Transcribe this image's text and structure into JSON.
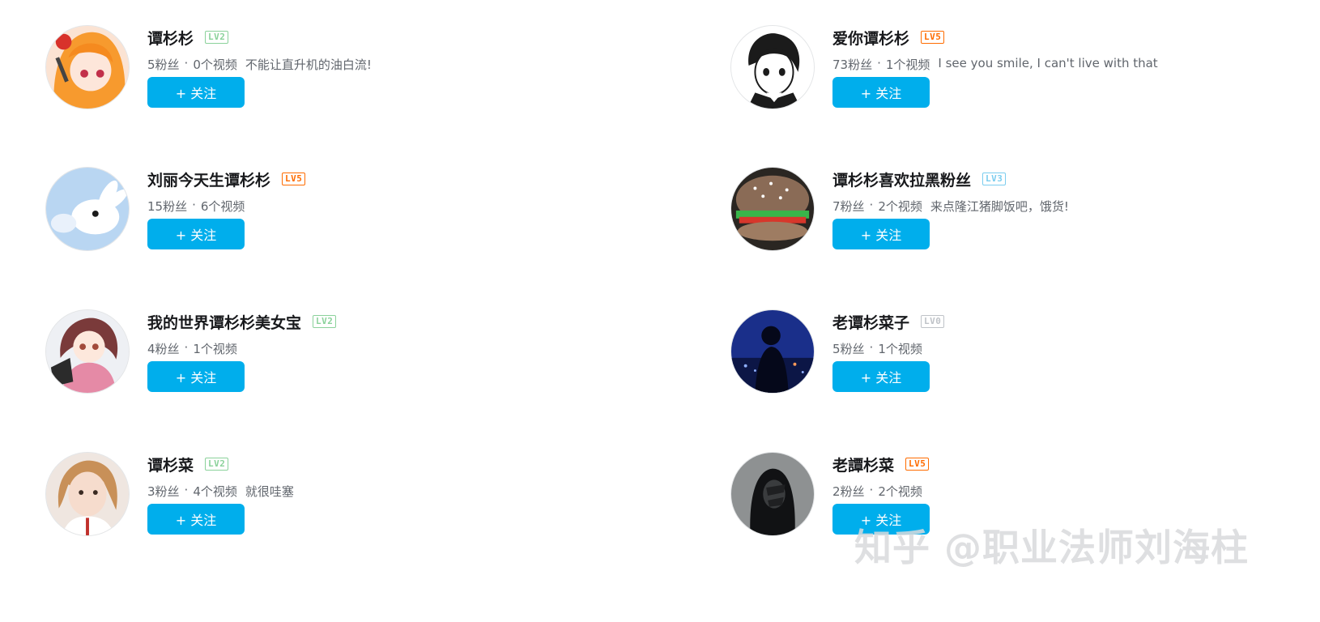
{
  "users": [
    {
      "name": "谭杉杉",
      "level": "LV2",
      "level_class": "lv2",
      "fans": "5粉丝",
      "videos": "0个视频",
      "sign": "不能让直升机的油白流!",
      "follow_label": "+ 关注",
      "avatar_icon": "anime-girl-orange-hair-avatar"
    },
    {
      "name": "爱你谭杉杉",
      "level": "LV5",
      "level_class": "lv5",
      "fans": "73粉丝",
      "videos": "1个视频",
      "sign": "I see you smile, I can't live with that",
      "follow_label": "+ 关注",
      "avatar_icon": "manga-boy-avatar"
    },
    {
      "name": "刘丽今天生谭杉杉",
      "level": "LV5",
      "level_class": "lv5",
      "fans": "15粉丝",
      "videos": "6个视频",
      "sign": "",
      "follow_label": "+ 关注",
      "avatar_icon": "white-rabbit-avatar"
    },
    {
      "name": "谭杉杉喜欢拉黑粉丝",
      "level": "LV3",
      "level_class": "lv3",
      "fans": "7粉丝",
      "videos": "2个视频",
      "sign": "来点隆江猪脚饭吧，饿货!",
      "follow_label": "+ 关注",
      "avatar_icon": "burger-avatar"
    },
    {
      "name": "我的世界谭杉杉美女宝",
      "level": "LV2",
      "level_class": "lv2",
      "fans": "4粉丝",
      "videos": "1个视频",
      "sign": "",
      "follow_label": "+ 关注",
      "avatar_icon": "anime-girl-pink-uniform-avatar"
    },
    {
      "name": "老谭杉菜子",
      "level": "LV0",
      "level_class": "lv0",
      "fans": "5粉丝",
      "videos": "1个视频",
      "sign": "",
      "follow_label": "+ 关注",
      "avatar_icon": "night-silhouette-avatar"
    },
    {
      "name": "谭杉菜",
      "level": "LV2",
      "level_class": "lv2",
      "fans": "3粉丝",
      "videos": "4个视频",
      "sign": "就很哇塞",
      "follow_label": "+ 关注",
      "avatar_icon": "girl-photo-avatar"
    },
    {
      "name": "老譚杉菜",
      "level": "LV5",
      "level_class": "lv5",
      "fans": "2粉丝",
      "videos": "2个视频",
      "sign": "",
      "follow_label": "+ 关注",
      "avatar_icon": "hooded-figure-avatar"
    }
  ],
  "separator": "·",
  "watermark": "知乎 @职业法师刘海柱",
  "colors": {
    "accent": "#00aeec",
    "lv0": "#bfc3c8",
    "lv2": "#8bd29b",
    "lv3": "#7bcdef",
    "lv5": "#ff6c00"
  }
}
